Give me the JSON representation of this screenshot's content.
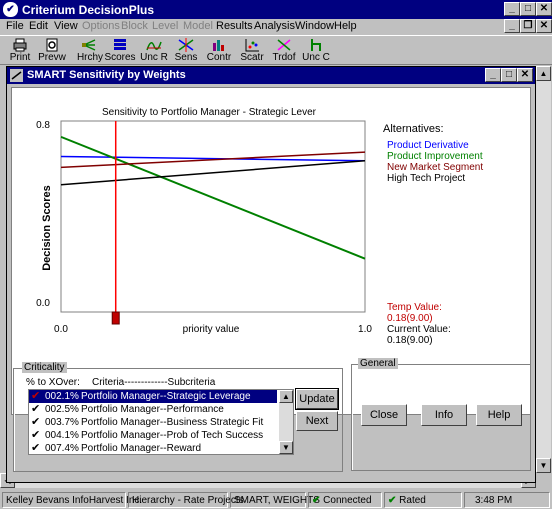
{
  "app": {
    "title": "Criterium DecisionPlus"
  },
  "menu": [
    {
      "label": "File",
      "enabled": true
    },
    {
      "label": "Edit",
      "enabled": true
    },
    {
      "label": "View",
      "enabled": true
    },
    {
      "label": "Options",
      "enabled": false
    },
    {
      "label": "Block",
      "enabled": false
    },
    {
      "label": "Level",
      "enabled": false
    },
    {
      "label": "Model",
      "enabled": false
    },
    {
      "label": "Results",
      "enabled": true
    },
    {
      "label": "Analysis",
      "enabled": true
    },
    {
      "label": "Window",
      "enabled": true
    },
    {
      "label": "Help",
      "enabled": true
    }
  ],
  "toolbar": [
    {
      "label": "Print",
      "icon": "printer-icon"
    },
    {
      "label": "Prevw",
      "icon": "preview-icon"
    },
    {
      "label": "Hrchy",
      "icon": "hierarchy-icon"
    },
    {
      "label": "Scores",
      "icon": "scores-icon"
    },
    {
      "label": "Unc R",
      "icon": "uncertainty-rank-icon"
    },
    {
      "label": "Sens",
      "icon": "sensitivity-icon"
    },
    {
      "label": "Contr",
      "icon": "contributions-icon"
    },
    {
      "label": "Scatr",
      "icon": "scatter-icon"
    },
    {
      "label": "Trdof",
      "icon": "tradeoff-icon"
    },
    {
      "label": "Unc C",
      "icon": "uncertainty-cumulative-icon"
    }
  ],
  "child": {
    "title": "SMART Sensitivity by Weights"
  },
  "chart_data": {
    "type": "line",
    "title": "Sensitivity to Portfolio Manager - Strategic Lever",
    "xlabel": "priority value",
    "ylabel": "Decision Scores",
    "xlim": [
      0.0,
      1.0
    ],
    "ylim": [
      0.0,
      0.8
    ],
    "x_ticks": [
      "0.0",
      "1.0"
    ],
    "y_ticks": [
      "0.0",
      "0.8"
    ],
    "legend_title": "Alternatives:",
    "series": [
      {
        "name": "Product Derivative",
        "color": "#0000ff",
        "x": [
          0.0,
          1.0
        ],
        "y": [
          0.66,
          0.64
        ]
      },
      {
        "name": "Product Improvement",
        "color": "#008000",
        "x": [
          0.0,
          1.0
        ],
        "y": [
          0.75,
          0.19
        ]
      },
      {
        "name": "New Market Segment",
        "color": "#800000",
        "x": [
          0.0,
          1.0
        ],
        "y": [
          0.61,
          0.68
        ]
      },
      {
        "name": "High Tech Project",
        "color": "#000000",
        "x": [
          0.0,
          1.0
        ],
        "y": [
          0.53,
          0.64
        ]
      }
    ],
    "marker_x": 0.18,
    "temp_value_label": "Temp Value:",
    "temp_value": "0.18(9.00)",
    "current_value_label": "Current Value:",
    "current_value": "0.18(9.00)"
  },
  "criticality": {
    "label": "Criticality",
    "header_pct": "% to XOver:",
    "header_crit": "Criteria-------------Subcriteria",
    "rows": [
      {
        "pct": "002.1%",
        "crit": "Portfolio Manager--Strategic Leverage",
        "selected": true
      },
      {
        "pct": "002.5%",
        "crit": "Portfolio Manager--Performance",
        "selected": false
      },
      {
        "pct": "003.7%",
        "crit": "Portfolio Manager--Business Strategic Fit",
        "selected": false
      },
      {
        "pct": "004.1%",
        "crit": "Portfolio Manager--Prob of Tech Success",
        "selected": false
      },
      {
        "pct": "007.4%",
        "crit": "Portfolio Manager--Reward",
        "selected": false
      }
    ],
    "update_label": "Update",
    "next_label": "Next"
  },
  "general": {
    "label": "General",
    "close_label": "Close",
    "info_label": "Info",
    "help_label": "Help"
  },
  "status": {
    "user": "Kelley Bevans InfoHarvest Inc.",
    "hierarchy": "Hierarchy - Rate Projects",
    "method": "SMART, WEIGHTS",
    "connected": "Connected",
    "rated": "Rated",
    "time": "3:48 PM"
  }
}
